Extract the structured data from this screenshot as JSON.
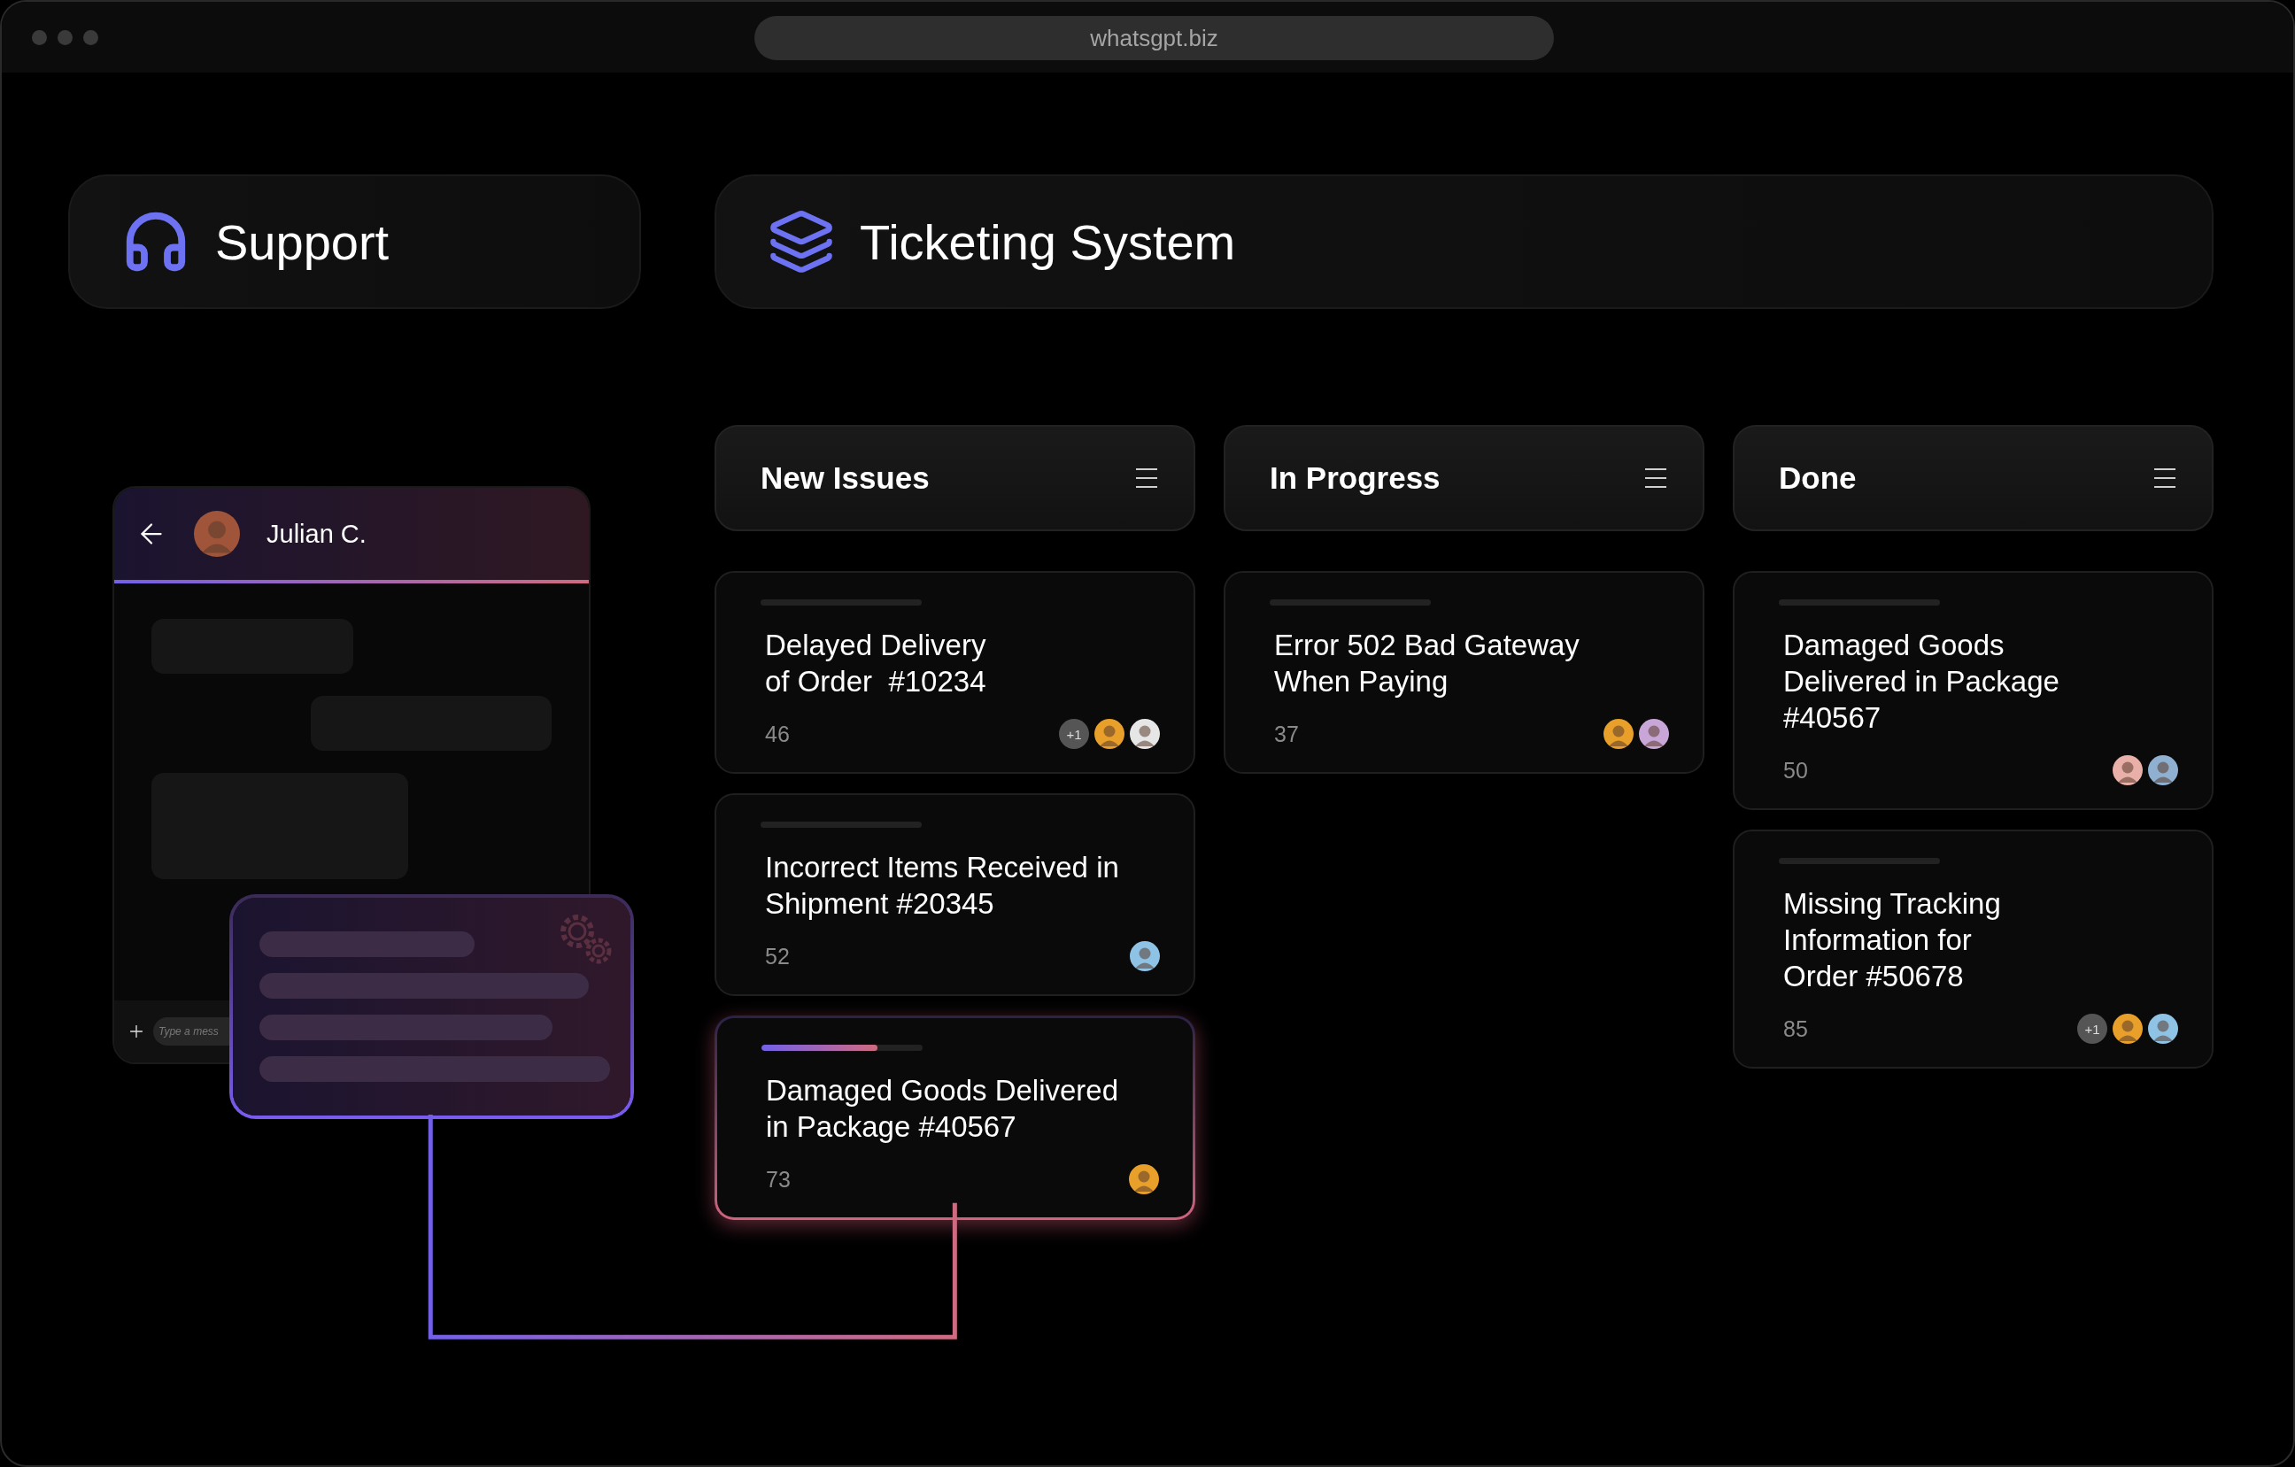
{
  "browser": {
    "url": "whatsgpt.biz"
  },
  "support": {
    "title": "Support"
  },
  "chat": {
    "contact": {
      "name": "Julian C.",
      "color": "#a0553a"
    },
    "input": {
      "placeholder": "Type a mess"
    }
  },
  "board": {
    "title": "Ticketing System",
    "columns": [
      {
        "title": "New Issues",
        "cards": [
          {
            "title": "Delayed Delivery\nof Order  #10234",
            "count": "46",
            "highlighted": false,
            "extra": "+1",
            "avatars": [
              {
                "color": "#e8a02a"
              },
              {
                "color": "#e6e6e6"
              }
            ]
          },
          {
            "title": "Incorrect Items Received in\nShipment #20345",
            "count": "52",
            "highlighted": false,
            "avatars": [
              {
                "color": "#8fc3e6"
              }
            ]
          },
          {
            "title": "Damaged Goods Delivered\nin Package #40567",
            "count": "73",
            "level": 0.72,
            "highlighted": true,
            "avatars": [
              {
                "color": "#e8a02a"
              }
            ]
          }
        ]
      },
      {
        "title": "In Progress",
        "cards": [
          {
            "title": "Error 502 Bad Gateway\nWhen Paying",
            "count": "37",
            "highlighted": false,
            "avatars": [
              {
                "color": "#e8a02a"
              },
              {
                "color": "#c9a6d8"
              }
            ]
          }
        ]
      },
      {
        "title": "Done",
        "cards": [
          {
            "title": "Damaged Goods\nDelivered in Package\n#40567",
            "count": "50",
            "highlighted": false,
            "avatars": [
              {
                "color": "#e8b0a8"
              },
              {
                "color": "#8fb0d0"
              }
            ]
          },
          {
            "title": "Missing Tracking\nInformation for\nOrder #50678",
            "count": "85",
            "highlighted": false,
            "extra": "+1",
            "avatars": [
              {
                "color": "#e8a02a"
              },
              {
                "color": "#8fc3e6"
              }
            ]
          }
        ]
      }
    ]
  }
}
